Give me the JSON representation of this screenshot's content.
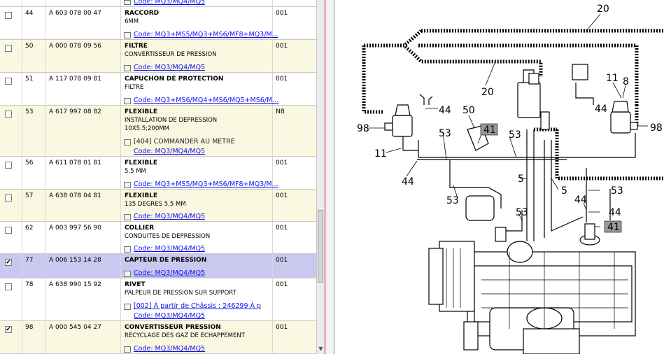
{
  "rows": [
    {
      "pos": "44",
      "ref": "A 603 078 00 47",
      "name": "RACCORD",
      "desc": "6MM",
      "qty": "001",
      "checked": false,
      "links": [
        "Code: MQ3+MS5/MQ3+MS6/MF8+MQ3/M..."
      ]
    },
    {
      "pos": "50",
      "ref": "A 000 078 09 56",
      "name": "FILTRE",
      "desc": "CONVERTISSEUR DE PRESSION",
      "qty": "001",
      "checked": false,
      "links": [
        "Code: MQ3/MQ4/MQ5"
      ]
    },
    {
      "pos": "51",
      "ref": "A 117 078 09 81",
      "name": "CAPUCHON DE PROTECTION",
      "desc": "FILTRE",
      "qty": "001",
      "checked": false,
      "links": [
        "Code: MQ3+MS6/MQ4+MS6/MQ5+MS6/M..."
      ]
    },
    {
      "pos": "53",
      "ref": "A 617 997 08 82",
      "name": "FLEXIBLE",
      "desc": "INSTALLATION DE DEPRESSION",
      "desc2": "10X5.5;200MM",
      "qty": "NB",
      "checked": false,
      "note": "[404] COMMANDER AU METRE",
      "links": [
        "Code: MQ3/MQ4/MQ5"
      ]
    },
    {
      "pos": "56",
      "ref": "A 611 078 01 81",
      "name": "FLEXIBLE",
      "desc": "5.5 MM",
      "qty": "001",
      "checked": false,
      "links": [
        "Code: MQ3+MS5/MQ3+MS6/MF8+MQ3/M..."
      ]
    },
    {
      "pos": "57",
      "ref": "A 638 078 04 81",
      "name": "FLEXIBLE",
      "desc": "135 DEGRES 5.5 MM",
      "qty": "001",
      "checked": false,
      "links": [
        "Code: MQ3/MQ4/MQ5"
      ]
    },
    {
      "pos": "62",
      "ref": "A 003 997 56 90",
      "name": "COLLIER",
      "desc": "CONDUITES DE DEPRESSION",
      "qty": "001",
      "checked": false,
      "links": [
        "Code: MQ3/MQ4/MQ5"
      ]
    },
    {
      "pos": "77",
      "ref": "A 006 153 14 28",
      "name": "CAPTEUR DE PRESSION",
      "desc": "",
      "qty": "001",
      "checked": true,
      "selected": true,
      "links": [
        "Code: MQ3/MQ4/MQ5"
      ]
    },
    {
      "pos": "78",
      "ref": "A 638 990 15 92",
      "name": "RIVET",
      "desc": "PALPEUR DE PRESSION SUR SUPPORT",
      "qty": "001",
      "checked": false,
      "note": "[002] À partir de Châssis : 246299 À p",
      "links": [
        "Code: MQ3/MQ4/MQ5"
      ]
    },
    {
      "pos": "98",
      "ref": "A 000 545 04 27",
      "name": "CONVERTISSEUR PRESSION",
      "desc": "RECYCLAGE DES GAZ DE ECHAPPEMENT",
      "qty": "001",
      "checked": true,
      "links": [
        "Code: MQ3/MQ4/MQ5"
      ]
    }
  ],
  "partial_top_link": "Code: MQ3/MQ4/MQ5",
  "scroll_down_glyph": "▼",
  "check_glyph": "✔",
  "diagram": {
    "labels": [
      "20",
      "20",
      "11",
      "8",
      "44",
      "98",
      "44",
      "50",
      "41",
      "53",
      "53",
      "98",
      "11",
      "44",
      "5",
      "5",
      "53",
      "53",
      "44",
      "44",
      "53",
      "41"
    ]
  },
  "colors": {
    "row_alt": "#fbf8e2",
    "row_selected": "#c9c9f0",
    "link": "#1010ee",
    "separator_red": "#e00000"
  }
}
